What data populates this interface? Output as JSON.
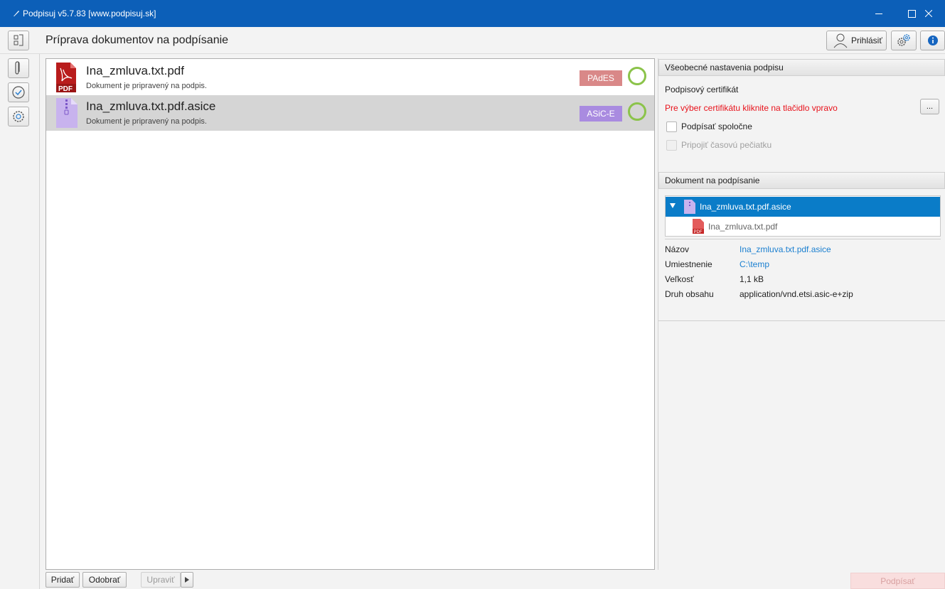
{
  "window": {
    "title": "Podpisuj v5.7.83 [www.podpisuj.sk]"
  },
  "header": {
    "page_title": "Príprava dokumentov na podpísanie",
    "login_label": "Prihlásiť"
  },
  "documents": [
    {
      "name": "Ina_zmluva.txt.pdf",
      "status": "Dokument je pripravený na podpis.",
      "format": "PAdES",
      "icon": "pdf-file-icon",
      "badge_color": "#d98888"
    },
    {
      "name": "Ina_zmluva.txt.pdf.asice",
      "status": "Dokument je pripravený na podpis.",
      "format": "ASiC-E",
      "icon": "zip-archive-file-icon",
      "badge_color": "#a98be0"
    }
  ],
  "bottom_bar": {
    "add_label": "Pridať",
    "remove_label": "Odobrať",
    "edit_label": "Upraviť",
    "sign_label": "Podpísať"
  },
  "settings": {
    "section_title": "Všeobecné nastavenia podpisu",
    "cert_label": "Podpisový certifikát",
    "cert_hint": "Pre výber certifikátu kliknite na tlačidlo vpravo",
    "browse_label": "...",
    "sign_together_label": "Podpísať spoločne",
    "timestamp_label": "Pripojiť časovú pečiatku"
  },
  "document_panel": {
    "section_title": "Dokument na podpísanie",
    "tree": {
      "root": "Ina_zmluva.txt.pdf.asice",
      "child": "Ina_zmluva.txt.pdf"
    },
    "properties": {
      "name_label": "Názov",
      "name_value": "Ina_zmluva.txt.pdf.asice",
      "location_label": "Umiestnenie",
      "location_value": "C:\\temp",
      "size_label": "Veľkosť",
      "size_value": "1,1 kB",
      "type_label": "Druh obsahu",
      "type_value": "application/vnd.etsi.asic-e+zip"
    }
  },
  "colors": {
    "titlebar": "#0c5fb8",
    "selection": "#0a7cc8",
    "link": "#1a7fd0",
    "error": "#e8121b",
    "ok_ring": "#8bc34a"
  }
}
